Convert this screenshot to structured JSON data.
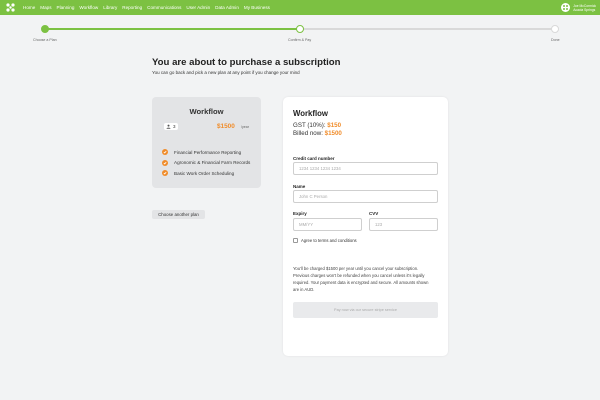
{
  "nav": {
    "items": [
      "Home",
      "Maps",
      "Planning",
      "Workflow",
      "Library",
      "Reporting",
      "Communications",
      "User Admin",
      "Data Admin",
      "My Business"
    ],
    "user_line1": "Joe McCormick",
    "user_line2": "Acacia Springs"
  },
  "stepper": {
    "steps": [
      "Choose a Plan",
      "Confirm & Pay",
      "Done"
    ],
    "current_step": 2,
    "progress_fraction": 0.5
  },
  "header": {
    "title": "You are about to purchase a subscription",
    "subtitle": "You can go back and pick a new plan at any point if you change your mind"
  },
  "plan": {
    "name": "Workflow",
    "seats": "3",
    "price": "$1500",
    "period": "/year",
    "features": [
      "Financial Performance Reporting",
      "Agronomic & Financial Farm Records",
      "Basic Work Order Scheduling"
    ],
    "choose_label": "Choose another plan"
  },
  "payment": {
    "title": "Workflow",
    "gst_label": "GST (10%):",
    "gst_value": "$150",
    "billed_label": "Billed now:",
    "billed_value": "$1500",
    "card_label": "Credit card number",
    "card_placeholder": "1234 1234 1234 1234",
    "name_label": "Name",
    "name_placeholder": "John C Person",
    "expiry_label": "Expiry",
    "expiry_placeholder": "MM/YY",
    "cvv_label": "CVV",
    "cvv_placeholder": "123",
    "terms_label": "Agree to terms and conditions",
    "notice": "You'll be charged $1500 per year until you cancel your subscription. Previous charges won't be refunded when you cancel unless it's legally required. Your payment data is encrypted and secure. All amounts shown are in AUD.",
    "pay_label": "Pay now via our secure stripe service"
  },
  "colors": {
    "brand_green": "#7cc142",
    "accent_orange": "#f08c2a"
  }
}
